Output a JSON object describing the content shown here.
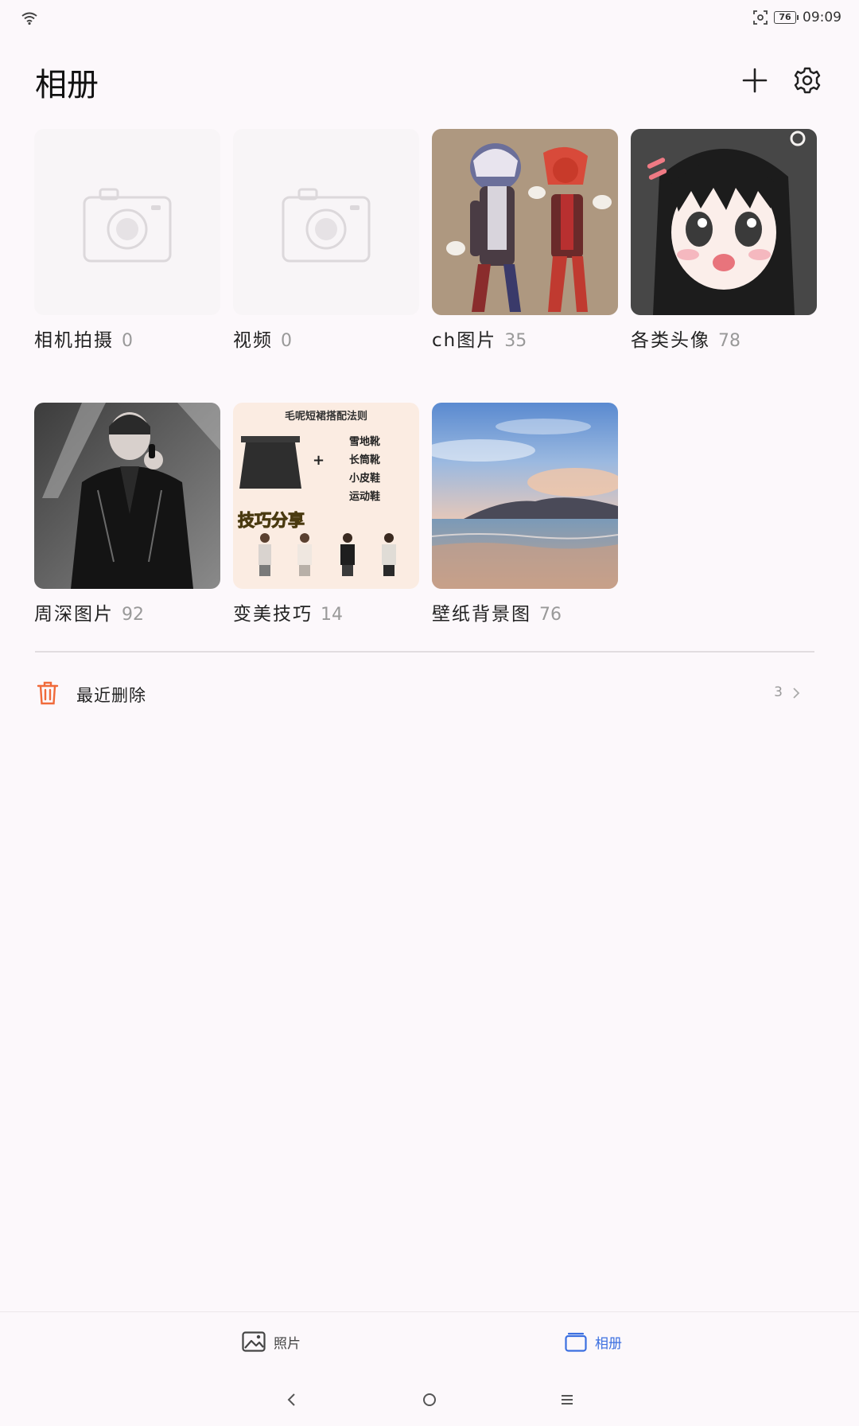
{
  "status_bar": {
    "battery": "76",
    "time": "09:09"
  },
  "header": {
    "title": "相册"
  },
  "albums": [
    {
      "name": "相机拍摄",
      "count": "0",
      "thumb": "camera-placeholder"
    },
    {
      "name": "视频",
      "count": "0",
      "thumb": "camera-placeholder"
    },
    {
      "name": "ch图片",
      "count": "35",
      "thumb": "anime-characters"
    },
    {
      "name": "各类头像",
      "count": "78",
      "thumb": "anime-girl"
    },
    {
      "name": "周深图片",
      "count": "92",
      "thumb": "singer-photo"
    },
    {
      "name": "变美技巧",
      "count": "14",
      "thumb": "fashion-tips",
      "thumb_text": {
        "title": "毛呢短裙搭配法则",
        "shoes": [
          "雪地靴",
          "长筒靴",
          "小皮鞋",
          "运动鞋"
        ],
        "plus": "+",
        "banner": "技巧分享"
      }
    },
    {
      "name": "壁纸背景图",
      "count": "76",
      "thumb": "beach-landscape"
    }
  ],
  "recently_deleted": {
    "label": "最近删除",
    "count": "3"
  },
  "bottom_nav": {
    "photos_label": "照片",
    "albums_label": "相册",
    "active": "albums",
    "active_color": "#3b6fe0"
  },
  "colors": {
    "background": "#fcf8fb",
    "trash": "#f06a3a",
    "accent": "#3b6fe0"
  }
}
